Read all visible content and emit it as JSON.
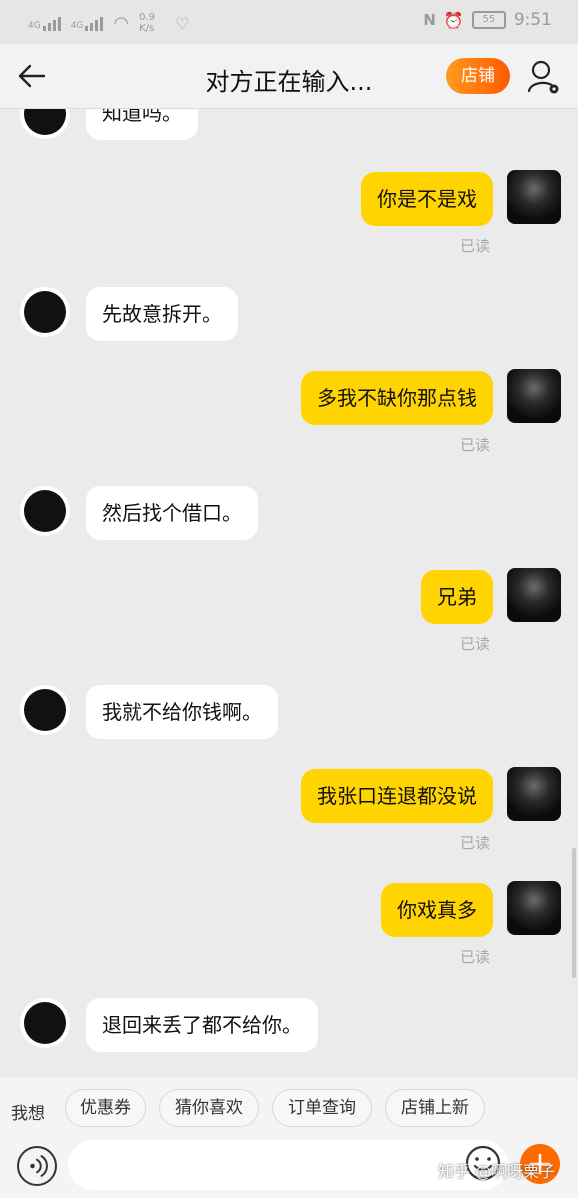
{
  "status_bar": {
    "signal_1": "4G",
    "signal_2": "4G",
    "net_speed": "0.9 K/s",
    "battery": "55",
    "time": "9:51"
  },
  "nav": {
    "title": "对方正在输入...",
    "shop_label": "店铺"
  },
  "messages": [
    {
      "side": "left",
      "text": "知道吗。"
    },
    {
      "side": "right",
      "text": "你是不是戏",
      "status": "已读"
    },
    {
      "side": "left",
      "text": "先故意拆开。"
    },
    {
      "side": "right",
      "text": "多我不缺你那点钱",
      "status": "已读"
    },
    {
      "side": "left",
      "text": "然后找个借口。"
    },
    {
      "side": "right",
      "text": "兄弟",
      "status": "已读"
    },
    {
      "side": "left",
      "text": "我就不给你钱啊。"
    },
    {
      "side": "right",
      "text": "我张口连退都没说",
      "status": "已读"
    },
    {
      "side": "right",
      "text": "你戏真多",
      "status": "已读"
    },
    {
      "side": "left",
      "text": "退回来丢了都不给你。"
    }
  ],
  "quick_replies": {
    "label": "我想",
    "chips": [
      "优惠券",
      "猜你喜欢",
      "订单查询",
      "店铺上新"
    ]
  },
  "input": {
    "placeholder": ""
  },
  "watermark": "知乎 @啊呀栗子",
  "colors": {
    "accent_orange": "#ff6a00",
    "bubble_yellow": "#ffd400",
    "background": "#ebebeb"
  }
}
